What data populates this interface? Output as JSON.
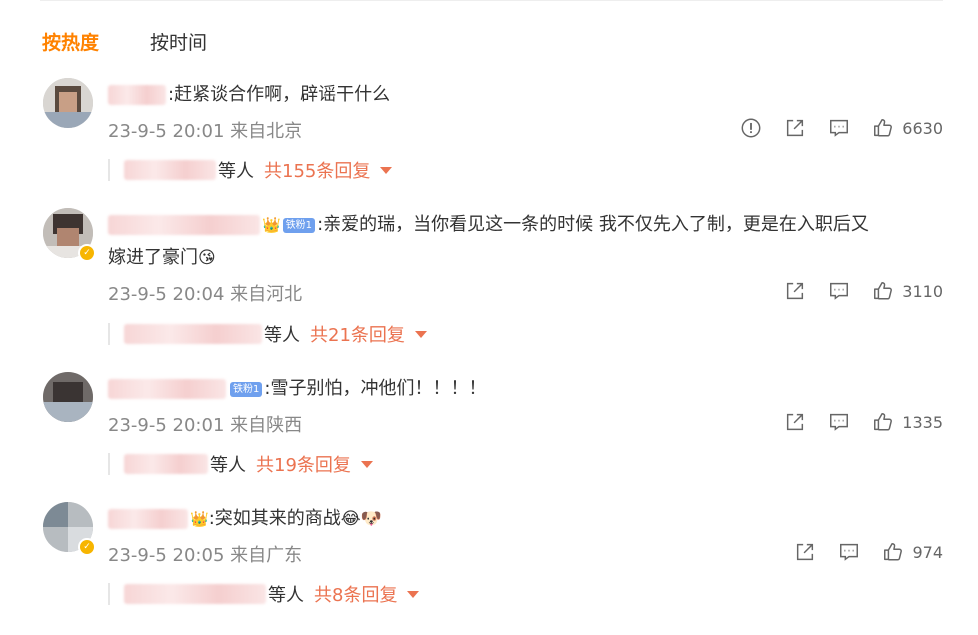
{
  "tabs": {
    "hot": "按热度",
    "time": "按时间"
  },
  "comments": [
    {
      "text": ":赶紧谈合作啊，辟谣干什么",
      "time": "23-9-5 20:01",
      "location": "来自北京",
      "likes": "6630",
      "replies_suffix": "等人",
      "replies_total": "共155条回复"
    },
    {
      "fan_badge": "铁粉1",
      "text_line1": ":亲爱的瑞，当你看见这一条的时候 我不仅先入了制，更是在入职后又",
      "text_line2": "嫁进了豪门",
      "time": "23-9-5 20:04",
      "location": "来自河北",
      "likes": "3110",
      "replies_suffix": "等人",
      "replies_total": "共21条回复"
    },
    {
      "fan_badge": "铁粉1",
      "text": ":雪子别怕，冲他们！！！！",
      "time": "23-9-5 20:01",
      "location": "来自陕西",
      "likes": "1335",
      "replies_suffix": "等人",
      "replies_total": "共19条回复"
    },
    {
      "text": ":突如其来的商战",
      "time": "23-9-5 20:05",
      "location": "来自广东",
      "likes": "974",
      "replies_suffix": "等人",
      "replies_total": "共8条回复"
    }
  ],
  "colors": {
    "accent": "#ff8200",
    "reply": "#eb7350",
    "meta": "#888888"
  },
  "icons": [
    "report-icon",
    "share-icon",
    "comment-icon",
    "like-icon",
    "caret-down-icon",
    "verified-icon",
    "crown-icon"
  ]
}
